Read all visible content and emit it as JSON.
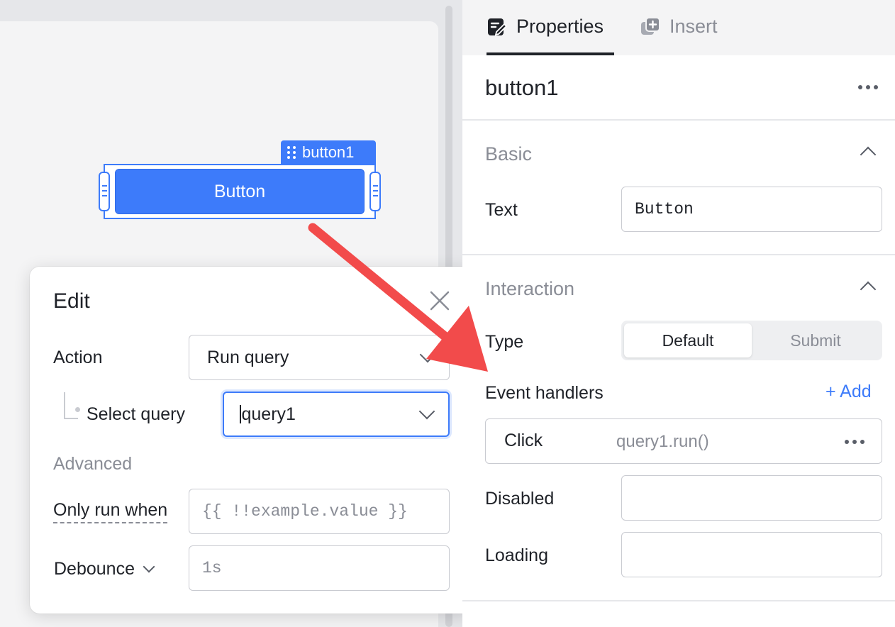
{
  "canvas": {
    "component_tag": "button1",
    "button_label": "Button"
  },
  "edit_popover": {
    "title": "Edit",
    "action_label": "Action",
    "action_value": "Run query",
    "select_query_label": "Select query",
    "select_query_value": "query1",
    "advanced_label": "Advanced",
    "only_run_when_label": "Only run when",
    "only_run_when_placeholder": "{{ !!example.value }}",
    "debounce_label": "Debounce",
    "debounce_placeholder": "1s"
  },
  "panel": {
    "tabs": [
      {
        "label": "Properties",
        "icon": "edit-icon",
        "active": true
      },
      {
        "label": "Insert",
        "icon": "insert-icon",
        "active": false
      }
    ],
    "component_name": "button1",
    "basic": {
      "title": "Basic",
      "text_label": "Text",
      "text_value": "Button"
    },
    "interaction": {
      "title": "Interaction",
      "type_label": "Type",
      "type_options": [
        "Default",
        "Submit"
      ],
      "type_selected": "Default",
      "event_handlers_label": "Event handlers",
      "add_label": "+ Add",
      "handlers": [
        {
          "event": "Click",
          "action": "query1.run()"
        }
      ],
      "disabled_label": "Disabled",
      "disabled_value": "",
      "loading_label": "Loading",
      "loading_value": ""
    }
  },
  "colors": {
    "accent": "#3d7bfa",
    "arrow": "#f24b4b",
    "canvas_bg": "#f4f4f5",
    "chrome_bg": "#e6e7ea"
  }
}
